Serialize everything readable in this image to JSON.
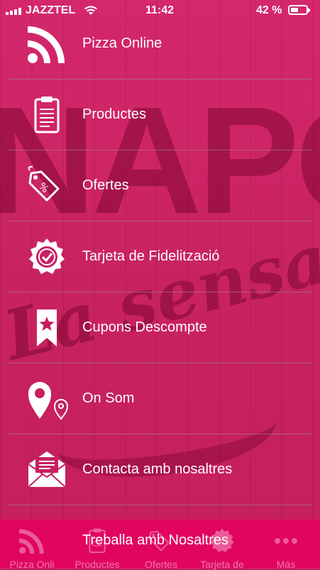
{
  "status_bar": {
    "carrier": "JAZZTEL",
    "time": "11:42",
    "battery_percent": "42 %",
    "battery_level": 0.42
  },
  "background": {
    "brand_word": "NAPOLI",
    "tagline": "La sensació"
  },
  "menu": {
    "items": [
      {
        "label": "Pizza Online",
        "icon": "rss-icon"
      },
      {
        "label": "Productes",
        "icon": "clipboard-icon"
      },
      {
        "label": "Ofertes",
        "icon": "discount-tag-icon"
      },
      {
        "label": "Tarjeta de Fidelització",
        "icon": "badge-check-icon"
      },
      {
        "label": "Cupons Descompte",
        "icon": "bookmark-star-icon"
      },
      {
        "label": "On Som",
        "icon": "map-pin-icon"
      },
      {
        "label": "Contacta amb nosaltres",
        "icon": "envelope-icon"
      },
      {
        "label": "Treballa amb Nosaltres",
        "icon": "briefcase-icon"
      }
    ]
  },
  "tabbar": {
    "tabs": [
      {
        "label": "Pizza Onli",
        "icon": "rss-icon"
      },
      {
        "label": "Productes",
        "icon": "clipboard-icon"
      },
      {
        "label": "Ofertes",
        "icon": "discount-tag-icon"
      },
      {
        "label": "Tarjeta de",
        "icon": "badge-check-icon"
      },
      {
        "label": "Más",
        "icon": "more-icon"
      }
    ]
  },
  "colors": {
    "primary": "#c81f63",
    "tabbar": "#e6005f",
    "text": "#ffffff"
  }
}
